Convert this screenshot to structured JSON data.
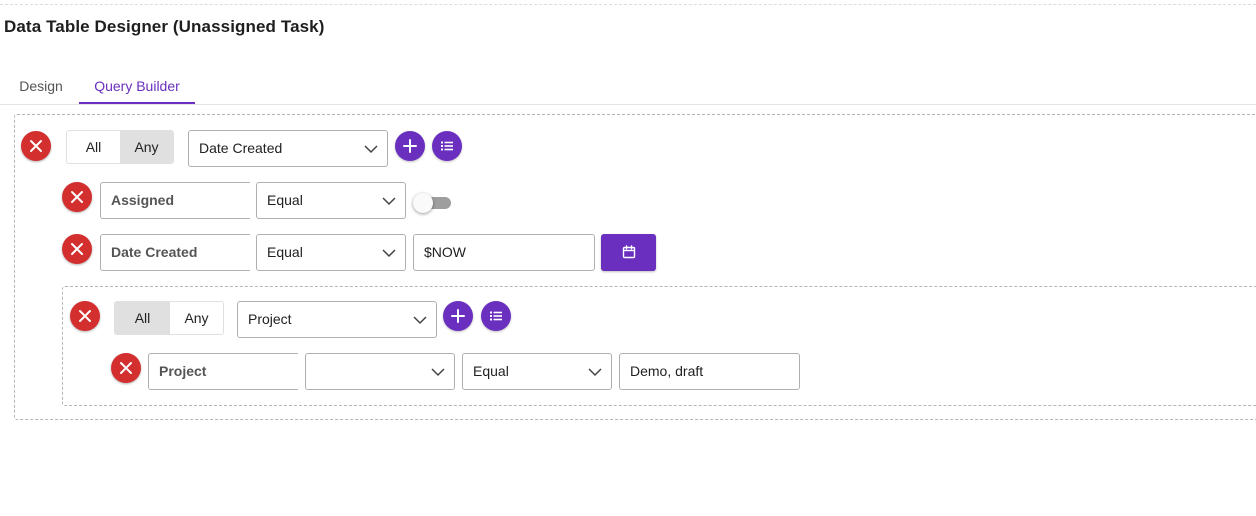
{
  "page": {
    "title": "Data Table Designer (Unassigned Task)"
  },
  "tabs": [
    {
      "label": "Design",
      "active": false
    },
    {
      "label": "Query Builder",
      "active": true
    }
  ],
  "colors": {
    "accent": "#6a2fbf",
    "danger": "#d32f2f",
    "selected_toggle": "#e0e0e0"
  },
  "outer_group": {
    "condition_options": [
      "All",
      "Any"
    ],
    "condition_selected": "Any",
    "field_select": "Date Created",
    "rules": [
      {
        "field": "Assigned",
        "operator": "Equal",
        "value_type": "toggle",
        "toggle_on": false
      },
      {
        "field": "Date Created",
        "operator": "Equal",
        "value": "$NOW",
        "value_type": "date"
      }
    ]
  },
  "inner_group": {
    "condition_options": [
      "All",
      "Any"
    ],
    "condition_selected": "All",
    "field_select": "Project",
    "rules": [
      {
        "field": "Project",
        "sub_select": "",
        "operator": "Equal",
        "value": "Demo, draft"
      }
    ]
  },
  "icons": {
    "delete": "close-icon",
    "add": "plus-icon",
    "list": "list-icon",
    "calendar": "calendar-icon",
    "dropdown": "chevron-down-icon"
  }
}
